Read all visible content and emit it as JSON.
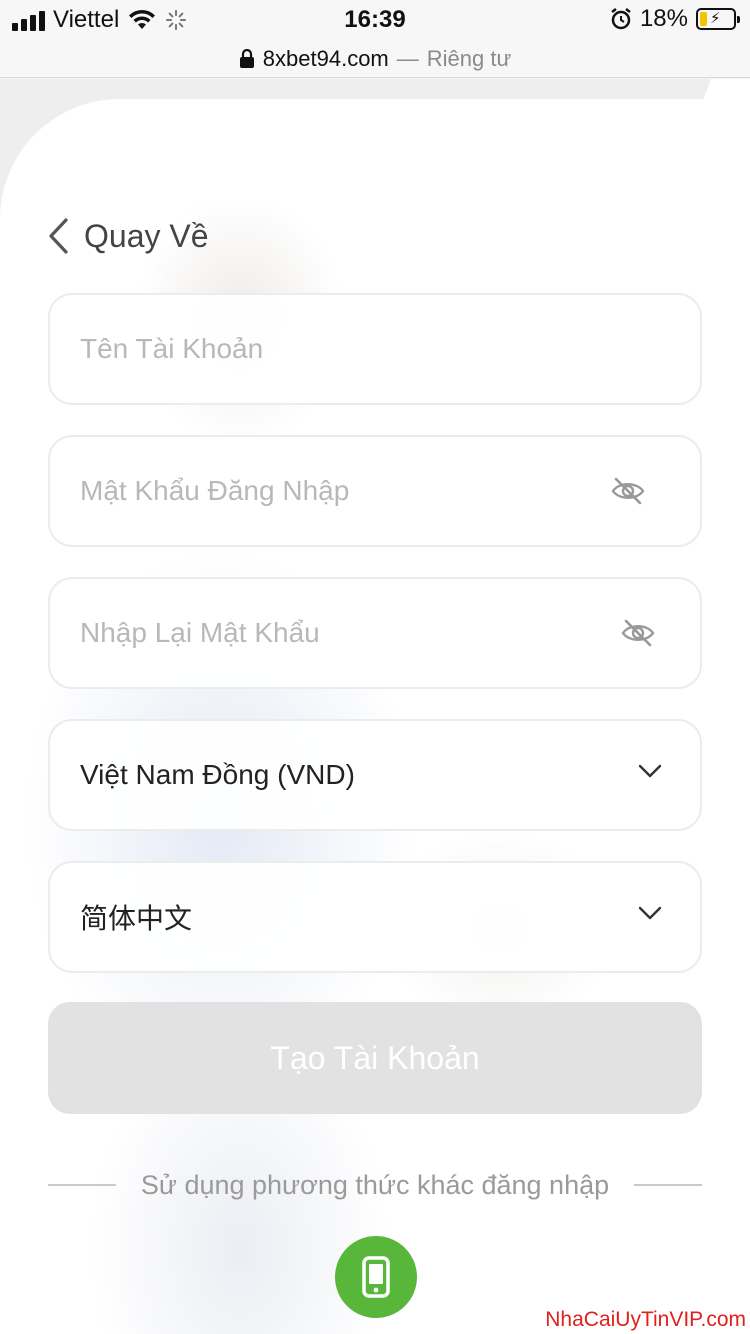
{
  "status_bar": {
    "carrier": "Viettel",
    "time": "16:39",
    "battery_percent": "18%",
    "icons": [
      "signal-icon",
      "wifi-icon",
      "loading-icon",
      "alarm-icon",
      "battery-charging-icon"
    ]
  },
  "url_bar": {
    "domain": "8xbet94.com",
    "separator": "—",
    "mode": "Riêng tư",
    "icon": "lock-icon"
  },
  "nav": {
    "back_label": "Quay Về",
    "back_icon": "chevron-left-icon"
  },
  "form": {
    "username_placeholder": "Tên Tài Khoản",
    "password_placeholder": "Mật Khẩu Đăng Nhập",
    "confirm_placeholder": "Nhập Lại Mật Khẩu",
    "currency_value": "Việt Nam Đồng (VND)",
    "language_value": "简体中文",
    "submit_label": "Tạo Tài Khoản"
  },
  "alt_login": {
    "text": "Sử dụng phương thức khác đăng nhập",
    "phone_icon": "phone-icon",
    "phone_color": "#58b63a"
  },
  "watermark": "NhaCaiUyTinVIP.com",
  "colors": {
    "button_disabled": "#e2e2e2",
    "watermark": "#e0201b"
  }
}
